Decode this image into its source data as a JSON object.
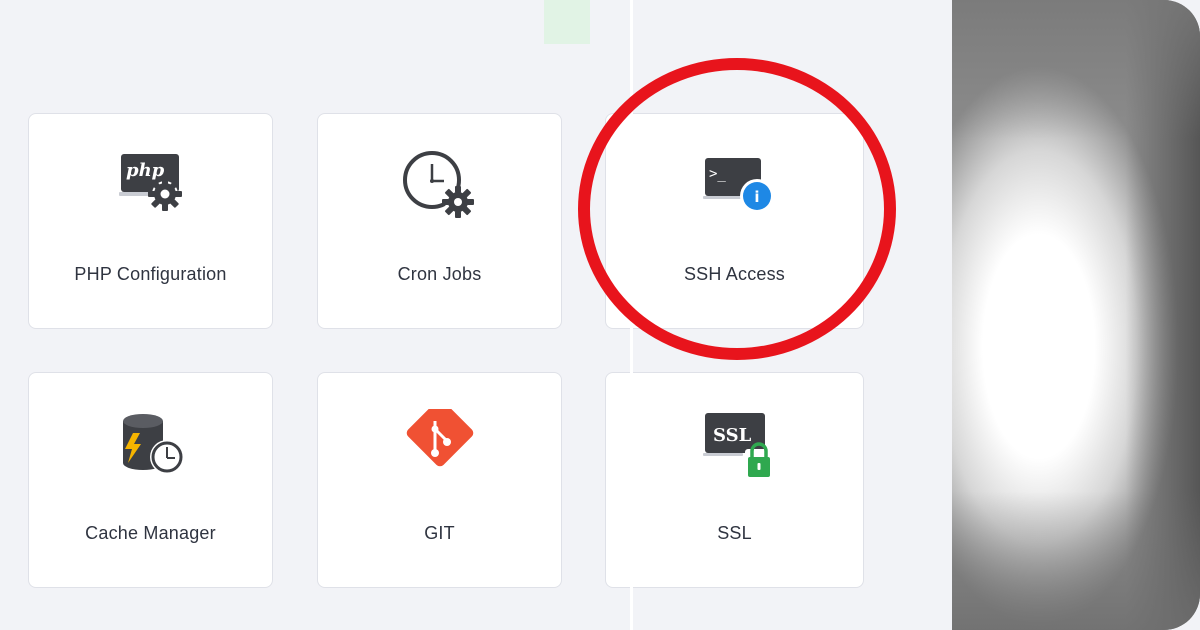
{
  "tiles": [
    {
      "label": "PHP Configuration",
      "icon": "php-settings-icon",
      "php_text": "php"
    },
    {
      "label": "Cron Jobs",
      "icon": "clock-gear-icon"
    },
    {
      "label": "SSH Access",
      "icon": "terminal-info-icon",
      "prompt_text": ">_",
      "info_text": "i"
    },
    {
      "label": "Cache Manager",
      "icon": "database-clock-icon"
    },
    {
      "label": "GIT",
      "icon": "git-icon"
    },
    {
      "label": "SSL",
      "icon": "ssl-lock-icon",
      "ssl_text": "SSL"
    }
  ],
  "colors": {
    "background": "#f2f3f7",
    "tile_border": "#dfe1e8",
    "highlight": "#e8141c",
    "git_red": "#f05133",
    "info_blue": "#1e88e5",
    "lock_green": "#2fa84f",
    "icon_dark": "#3d3f44"
  }
}
